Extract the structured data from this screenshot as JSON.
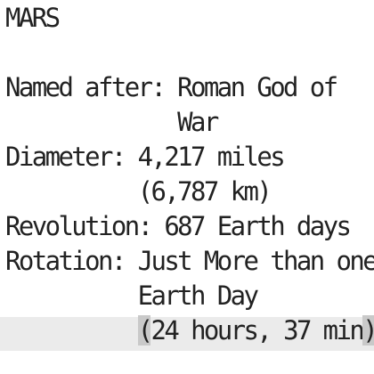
{
  "document": {
    "title": "MARS",
    "lines": {
      "named_after_1": "Named after: Roman God of",
      "named_after_2": "             War",
      "diameter_1": "Diameter: 4,217 miles",
      "diameter_2": "          (6,787 km)",
      "revolution": "Revolution: 687 Earth days",
      "rotation_1": "Rotation: Just More than one",
      "rotation_2": "          Earth Day",
      "rotation_3_indent": "          ",
      "rotation_3_open": "(",
      "rotation_3_body": "24 hours, 37 min",
      "rotation_3_close": ")"
    }
  },
  "colors": {
    "text": "#222222",
    "current_line": "#ebebeb",
    "bracket_match": "#c9c9c9",
    "background": "#ffffff"
  }
}
